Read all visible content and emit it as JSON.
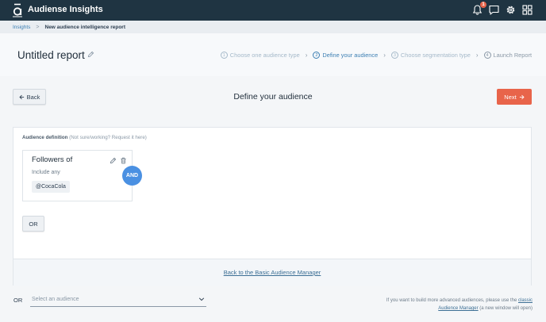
{
  "app": {
    "title": "Audiense Insights",
    "notification_count": "1"
  },
  "breadcrumb": {
    "root": "Insights",
    "separator": ">",
    "current": "New audience intelligence report"
  },
  "header": {
    "report_title": "Untitled report"
  },
  "steps": [
    {
      "num": "1",
      "label": "Choose one audience type"
    },
    {
      "num": "2",
      "label": "Define your audience"
    },
    {
      "num": "3",
      "label": "Choose segmentation type"
    },
    {
      "num": "4",
      "label": "Launch Report"
    }
  ],
  "actions": {
    "back_label": "Back",
    "next_label": "Next",
    "section_title": "Define your audience"
  },
  "definition": {
    "label": "Audience definition",
    "help": "(Not sure/working? Request it here)",
    "box_title": "Followers of",
    "include_label": "Include any",
    "chip": "@CocaCola",
    "and_label": "AND",
    "or_label": "OR",
    "basic_link": "Back to the Basic Audience Manager"
  },
  "bottom": {
    "or_label": "OR",
    "select_placeholder": "Select an audience",
    "note_prefix": "If you want to build more advanced audiences, please use the",
    "note_link": "classic Audience Manager",
    "note_suffix": "(a new window will open)"
  },
  "colors": {
    "topbar": "#1f3442",
    "accent": "#e8644a",
    "link": "#3c7fb3",
    "and_badge": "#4a90e2"
  },
  "icons": [
    "audiense-logo-icon",
    "bell-icon",
    "chat-icon",
    "gear-icon",
    "grid-icon",
    "pencil-icon",
    "trash-icon",
    "arrow-left-icon",
    "arrow-right-icon",
    "chevron-down-icon"
  ]
}
